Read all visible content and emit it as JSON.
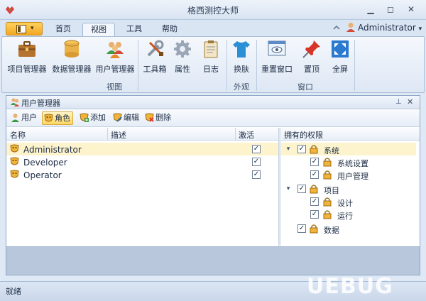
{
  "window": {
    "title": "格西测控大师",
    "icons": {
      "app": "app-logo-icon",
      "minimize": "minimize-icon",
      "restore": "restore-icon",
      "close": "close-icon"
    }
  },
  "ribbon": {
    "tabs": [
      "首页",
      "视图",
      "工具",
      "帮助"
    ],
    "active_tab": "视图",
    "user": "Administrator",
    "buttons": [
      {
        "label": "项目管理器",
        "icon": "briefcase-icon"
      },
      {
        "label": "数据管理器",
        "icon": "database-icon"
      },
      {
        "label": "用户管理器",
        "icon": "users-icon"
      },
      {
        "label": "工具箱",
        "icon": "toolbox-icon"
      },
      {
        "label": "属性",
        "icon": "gear-icon"
      },
      {
        "label": "日志",
        "icon": "clipboard-icon"
      },
      {
        "label": "换肤",
        "icon": "shirt-icon"
      },
      {
        "label": "重置窗口",
        "icon": "window-eye-icon"
      },
      {
        "label": "置顶",
        "icon": "pushpin-icon"
      },
      {
        "label": "全屏",
        "icon": "fullscreen-icon"
      }
    ],
    "groups": {
      "view": "视图",
      "appearance": "外观",
      "window": "窗口"
    }
  },
  "panel": {
    "title": "用户管理器",
    "pin_icon": "pin-icon",
    "close_icon": "close-icon",
    "toolbar": [
      {
        "label": "用户",
        "icon": "user-icon",
        "active": false
      },
      {
        "label": "角色",
        "icon": "role-mask-icon",
        "active": true
      },
      {
        "label": "添加",
        "icon": "add-icon",
        "active": false
      },
      {
        "label": "编辑",
        "icon": "edit-icon",
        "active": false
      },
      {
        "label": "删除",
        "icon": "delete-icon",
        "active": false
      }
    ],
    "table": {
      "columns": [
        "名称",
        "描述",
        "激活"
      ],
      "rows": [
        {
          "name": "Administrator",
          "desc": "",
          "active": true
        },
        {
          "name": "Developer",
          "desc": "",
          "active": true
        },
        {
          "name": "Operator",
          "desc": "",
          "active": true
        }
      ]
    },
    "permissions": {
      "header": "拥有的权限",
      "items": [
        {
          "label": "系统",
          "level": 0,
          "expanded": true,
          "checked": true
        },
        {
          "label": "系统设置",
          "level": 1,
          "checked": true
        },
        {
          "label": "用户管理",
          "level": 1,
          "checked": true
        },
        {
          "label": "项目",
          "level": 0,
          "expanded": true,
          "checked": true
        },
        {
          "label": "设计",
          "level": 1,
          "checked": true
        },
        {
          "label": "运行",
          "level": 1,
          "checked": true
        },
        {
          "label": "数据",
          "level": 0,
          "checked": true
        }
      ]
    }
  },
  "status": {
    "text": "就绪"
  },
  "watermark": {
    "text": "UEBUG"
  },
  "colors": {
    "accent": "#f2a624",
    "selection": "#fdf3cc",
    "frame": "#dfe8f5"
  }
}
